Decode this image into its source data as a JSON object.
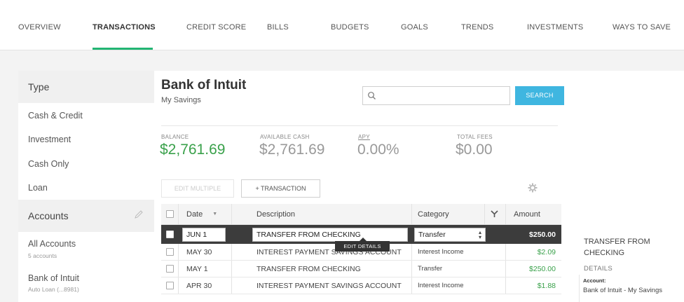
{
  "nav": {
    "items": [
      "OVERVIEW",
      "TRANSACTIONS",
      "CREDIT SCORE",
      "BILLS",
      "BUDGETS",
      "GOALS",
      "TRENDS",
      "INVESTMENTS",
      "WAYS TO SAVE"
    ],
    "active": "TRANSACTIONS"
  },
  "sidebar": {
    "type_heading": "Type",
    "type_items": [
      "Cash & Credit",
      "Investment",
      "Cash Only",
      "Loan"
    ],
    "accounts_heading": "Accounts",
    "accounts": [
      {
        "name": "All Accounts",
        "sub": "5 accounts"
      },
      {
        "name": "Bank of Intuit",
        "sub": "Auto Loan (...8981)"
      }
    ]
  },
  "account": {
    "title": "Bank of Intuit",
    "subtitle": "My Savings"
  },
  "search": {
    "placeholder": "",
    "button_label": "SEARCH"
  },
  "stats": [
    {
      "label": "BALANCE",
      "value": "$2,761.69"
    },
    {
      "label": "AVAILABLE CASH",
      "value": "$2,761.69"
    },
    {
      "label": "APY",
      "value": "0.00%"
    },
    {
      "label": "TOTAL FEES",
      "value": "$0.00"
    }
  ],
  "toolbar": {
    "edit_multiple": "EDIT MULTIPLE",
    "add_transaction": "+ TRANSACTION"
  },
  "table": {
    "headers": {
      "date": "Date",
      "description": "Description",
      "category": "Category",
      "amount": "Amount"
    },
    "rows": [
      {
        "date": "JUN 1",
        "description": "TRANSFER FROM CHECKING",
        "category": "Transfer",
        "amount": "$250.00",
        "selected": true
      },
      {
        "date": "MAY 30",
        "description": "INTEREST PAYMENT SAVINGS ACCOUNT",
        "category": "Interest Income",
        "amount": "$2.09"
      },
      {
        "date": "MAY 1",
        "description": "TRANSFER FROM CHECKING",
        "category": "Transfer",
        "amount": "$250.00"
      },
      {
        "date": "APR 30",
        "description": "INTEREST PAYMENT SAVINGS ACCOUNT",
        "category": "Interest Income",
        "amount": "$1.88"
      }
    ],
    "tooltip": "EDIT DETAILS"
  },
  "details": {
    "title": "TRANSFER FROM CHECKING",
    "section": "DETAILS",
    "account_label": "Account:",
    "account_value": "Bank of Intuit - My Savings"
  },
  "colors": {
    "accent_green": "#22b573",
    "positive": "#3aa14b",
    "search_button": "#3fb6e0",
    "selected_row": "#3c3c3c"
  }
}
